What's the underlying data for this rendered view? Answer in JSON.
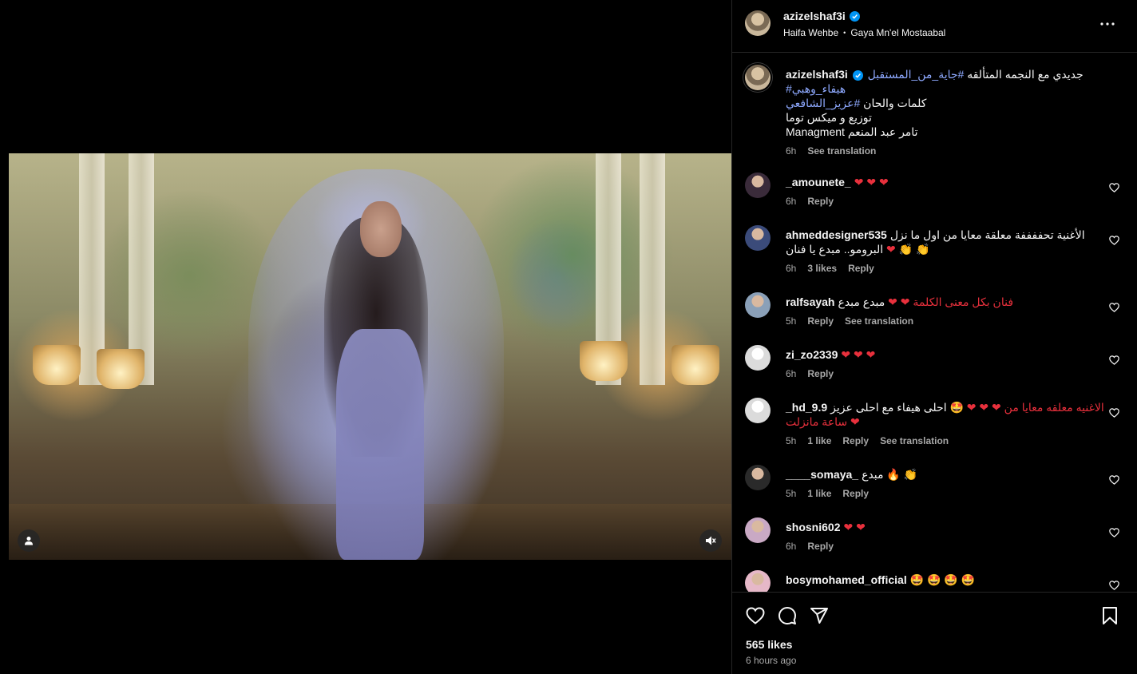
{
  "post": {
    "author": "azizelshaf3i",
    "music_artist": "Haifa Wehbe",
    "music_separator": "•",
    "music_title": "Gaya Mn'el Mostaabal"
  },
  "caption": {
    "username": "azizelshaf3i",
    "hashtag1": "#جاية_من_المستقبل",
    "text1": " جديدي مع النجمه المتألقه ",
    "hashtag2": "#هيفاء_وهبي",
    "line2_text": "كلمات والحان ",
    "line2_hashtag": "#عزيز_الشافعي",
    "line3": "توزيع و ميكس توما",
    "line4": "Managment تامر عبد المنعم",
    "time": "6h",
    "see_translation": "See translation"
  },
  "comments": [
    {
      "username": "_amounete_",
      "text": "",
      "emoji": "❤ ❤ ❤",
      "time": "6h",
      "likes": "",
      "reply": "Reply",
      "translate": "",
      "avatar_color": "#3a2b3a"
    },
    {
      "username": "ahmeddesigner535",
      "text": "الأغنية تحففففة معلقة معايا من اول ما نزل البرومو.. مبدع يا فنان",
      "emoji": "❤ 👏 👏",
      "time": "6h",
      "likes": "3 likes",
      "reply": "Reply",
      "translate": "",
      "avatar_color": "#3b4b7a"
    },
    {
      "username": "ralfsayah",
      "text": "مبدع مبدع",
      "emoji": "❤ ❤ فنان بكل معنى الكلمة",
      "time": "5h",
      "likes": "",
      "reply": "Reply",
      "translate": "See translation",
      "avatar_color": "#8aa0b8"
    },
    {
      "username": "zi_zo2339",
      "text": "",
      "emoji": "❤ ❤ ❤",
      "time": "6h",
      "likes": "",
      "reply": "Reply",
      "translate": "",
      "avatar_color": "#dbdbdb"
    },
    {
      "username": "_hd_9.9",
      "text": "احلى هيفاء مع احلى عزيز",
      "emoji": "🤩 ❤ ❤ ❤ الاغنيه معلقه معايا من ساعة مانزلت ❤",
      "time": "5h",
      "likes": "1 like",
      "reply": "Reply",
      "translate": "See translation",
      "avatar_color": "#dbdbdb"
    },
    {
      "username": "____somaya_",
      "text": "مبدع",
      "emoji": "🔥 👏",
      "time": "5h",
      "likes": "1 like",
      "reply": "Reply",
      "translate": "",
      "avatar_color": "#2a2a2a"
    },
    {
      "username": "shosni602",
      "text": "",
      "emoji": "❤ ❤",
      "time": "6h",
      "likes": "",
      "reply": "Reply",
      "translate": "",
      "avatar_color": "#c9a9c4"
    },
    {
      "username": "bosymohamed_official",
      "text": "",
      "emoji": "🤩 🤩 🤩 🤩",
      "time": "",
      "likes": "",
      "reply": "",
      "translate": "",
      "avatar_color": "#e6b8c8"
    }
  ],
  "footer": {
    "likes": "565 likes",
    "time": "6 hours ago"
  },
  "icons": {
    "like": "heart-icon",
    "comment": "comment-icon",
    "share": "share-icon",
    "save": "bookmark-icon",
    "more": "more-icon",
    "mute": "muted-icon",
    "tagged": "user-icon",
    "verified": "verified-icon"
  },
  "colors": {
    "hashtag": "#8ea9ff",
    "verified": "#0095f6",
    "heart": "#e8303c"
  }
}
